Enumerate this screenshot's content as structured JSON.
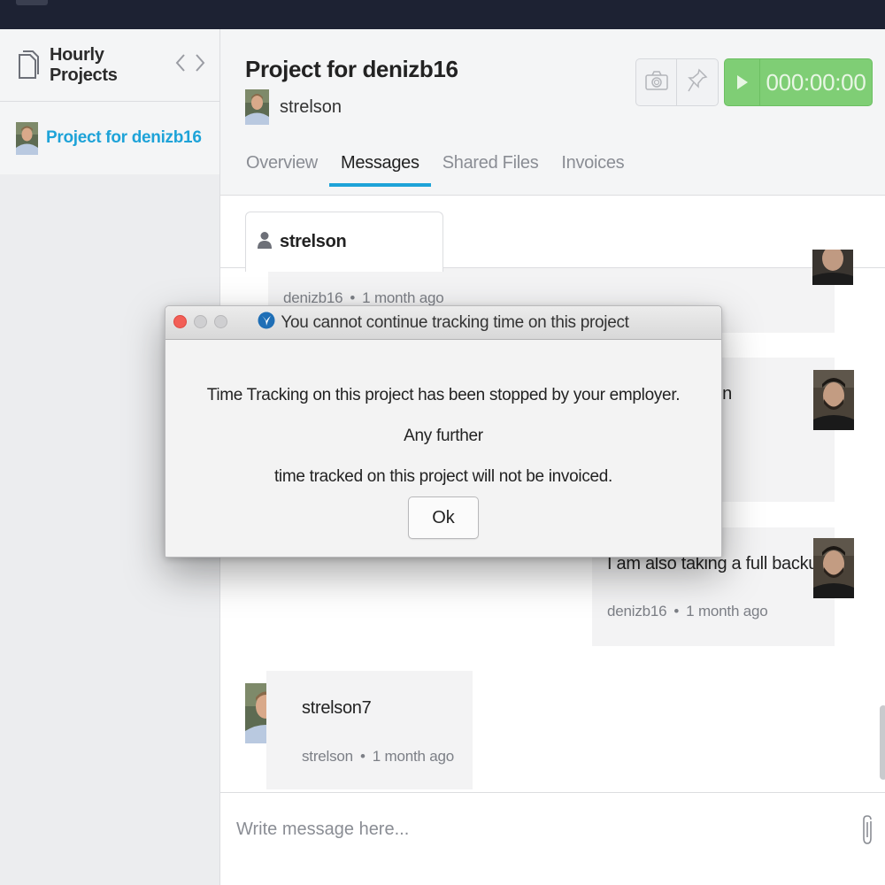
{
  "sidebar": {
    "title": "Hourly Projects",
    "prev_icon": "chevron-left-icon",
    "next_icon": "chevron-right-icon",
    "items": [
      {
        "label": "Project for denizb16",
        "active": true
      }
    ]
  },
  "project": {
    "title": "Project for denizb16",
    "owner": "strelson"
  },
  "toolbar": {
    "camera_icon": "camera-icon",
    "pin_icon": "pin-icon",
    "timer": "000:00:00",
    "timer_color": "#7fce75"
  },
  "tabs": [
    {
      "label": "Overview",
      "active": false
    },
    {
      "label": "Messages",
      "active": true
    },
    {
      "label": "Shared Files",
      "active": false
    },
    {
      "label": "Invoices",
      "active": false
    }
  ],
  "thread": {
    "contact": "strelson",
    "messages": [
      {
        "text": "",
        "author": "denizb16",
        "time": "1 month ago"
      },
      {
        "text": "rs on",
        "author": "",
        "time": ""
      },
      {
        "text": "I am also taking a full backup.",
        "author": "denizb16",
        "time": "1 month ago"
      },
      {
        "text": "strelson7",
        "author": "strelson",
        "time": "1 month ago"
      }
    ]
  },
  "composer": {
    "placeholder": "Write message here...",
    "attach_icon": "paperclip-icon"
  },
  "dialog": {
    "title": "You cannot continue tracking time on this project",
    "line1": "Time Tracking on this project has been stopped by your employer. Any further",
    "line2": "time tracked on this project will not be invoiced.",
    "ok_label": "Ok"
  },
  "colors": {
    "accent": "#1ea3d8",
    "topbar": "#1d2233",
    "timer_green": "#7fce75",
    "close_red": "#f25f57"
  }
}
